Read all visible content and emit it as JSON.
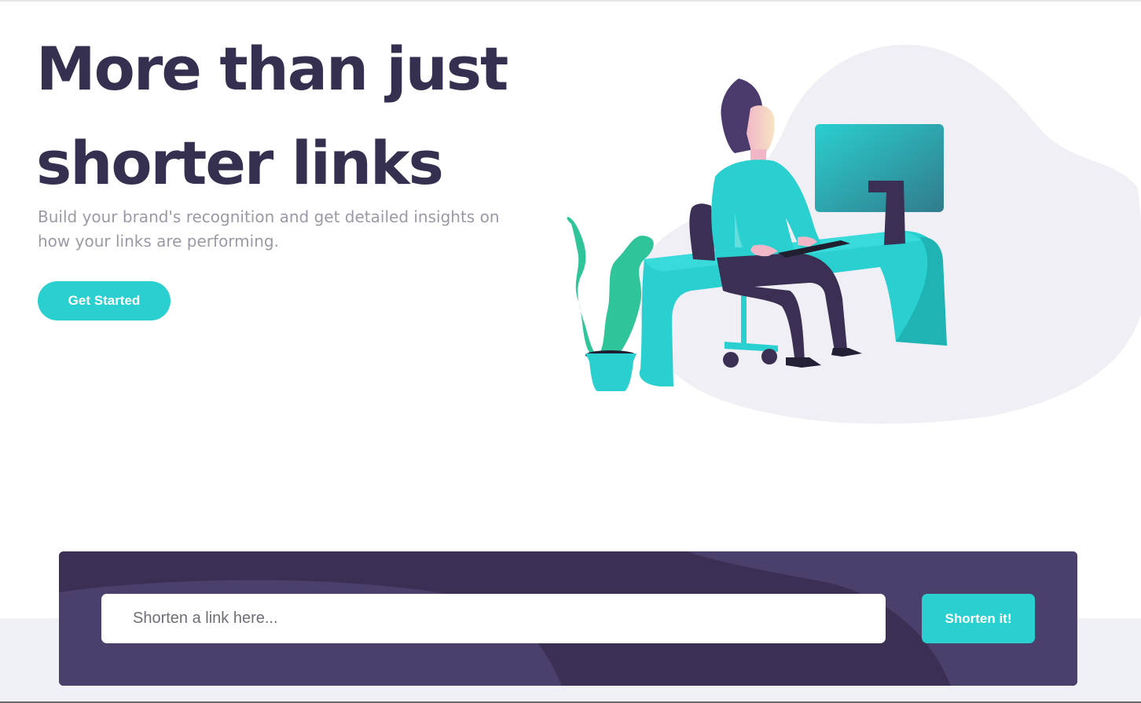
{
  "hero": {
    "title_line_1": "More than just",
    "title_line_2": "shorter links",
    "subtitle": "Build your brand's recognition and get detailed insights on how your links are performing.",
    "cta_label": "Get Started"
  },
  "shorten": {
    "placeholder": "Shorten a link here...",
    "value": "",
    "button_label": "Shorten it!"
  },
  "colors": {
    "primary_cyan": "#2acfcf",
    "dark_violet": "#3b3054",
    "very_dark_blue": "#35304f",
    "grayish_violet": "#9a9aa6",
    "light_gray": "#f0f1f6"
  },
  "illustration": {
    "icon": "person-working-illustration"
  }
}
